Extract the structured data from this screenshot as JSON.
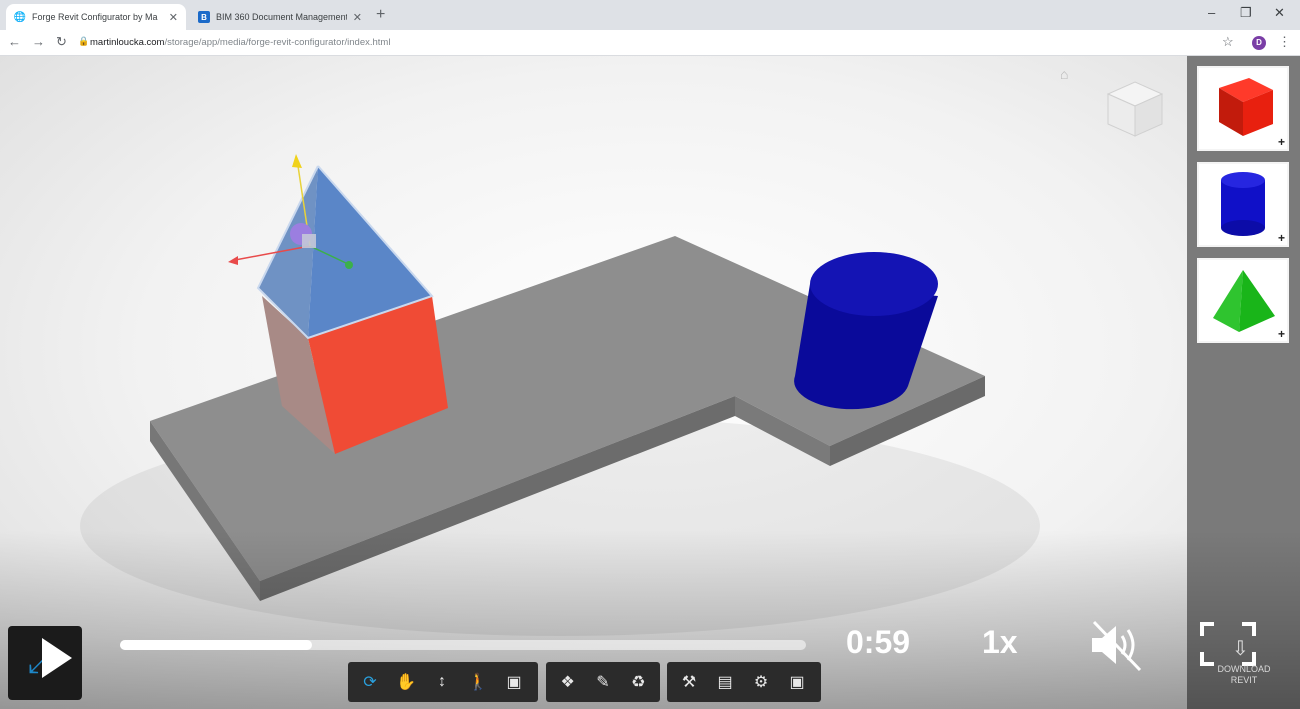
{
  "browser": {
    "tabs": [
      {
        "title": "Forge Revit Configurator by Ma",
        "active": true,
        "icon": "globe-icon"
      },
      {
        "title": "BIM 360 Document Management",
        "active": false,
        "icon": "bim360-icon"
      }
    ],
    "url_host": "martinloucka.com",
    "url_path": "/storage/app/media/forge-revit-configurator/index.html",
    "profile_initial": "D"
  },
  "panel": {
    "items": [
      {
        "name": "cube",
        "color": "#e8200f",
        "icon": "red-cube-icon"
      },
      {
        "name": "cylinder",
        "color": "#1010c8",
        "icon": "blue-cylinder-icon"
      },
      {
        "name": "pyramid",
        "color": "#19b519",
        "icon": "green-pyramid-icon"
      }
    ],
    "add_symbol": "+"
  },
  "video": {
    "time": "0:59",
    "speed": "1x",
    "progress_fraction": 0.28,
    "buffer_fraction": 0.94,
    "muted": true
  },
  "download": {
    "label_line1": "DOWNLOAD",
    "label_line2": "REVIT"
  },
  "toolbar": {
    "groups": [
      [
        "orbit-icon",
        "pan-icon",
        "zoom-icon",
        "first-person-icon",
        "camera-icon"
      ],
      [
        "explode-icon",
        "measure-icon",
        "section-icon"
      ],
      [
        "model-browser-icon",
        "properties-icon",
        "settings-icon",
        "fullscreen-icon"
      ]
    ],
    "active_tool": "orbit-icon"
  },
  "colors": {
    "accent": "#2aa1de",
    "slab": "#8a8a8a",
    "cube_front": "#f04b35",
    "pyramid": "#5a86c8",
    "cylinder": "#0a0a9a"
  }
}
